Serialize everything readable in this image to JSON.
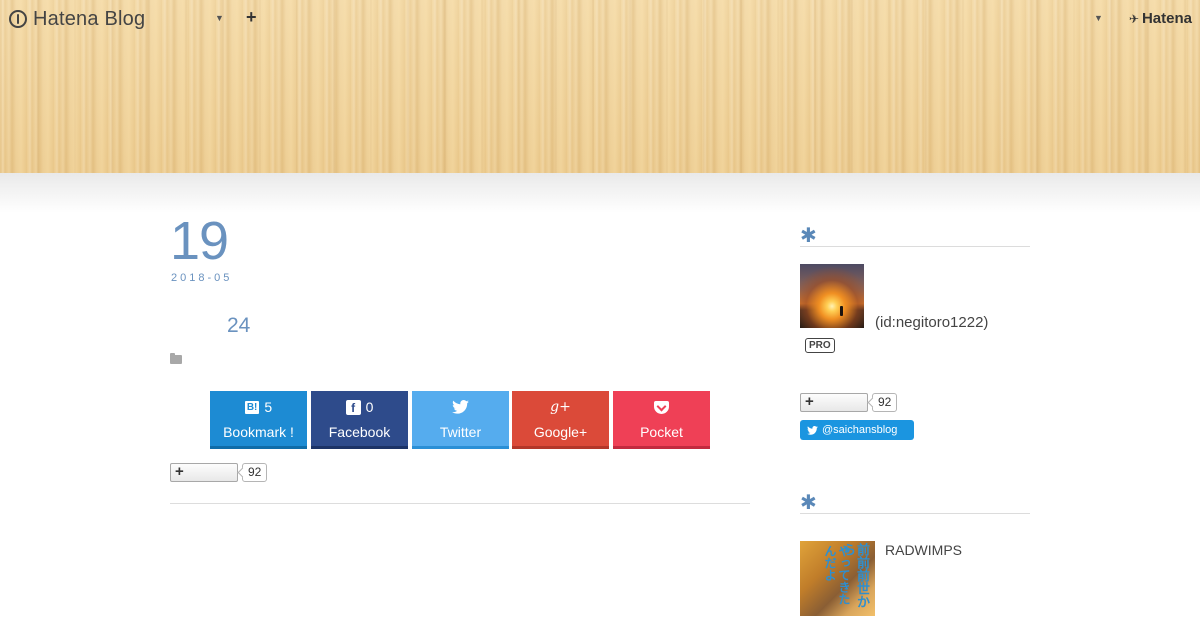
{
  "header": {
    "blog_title": "Hatena Blog",
    "add_icon": "plus-icon",
    "brand": "Hatena"
  },
  "article": {
    "day": "19",
    "year_month": "2018-05",
    "title": "24",
    "category_icon": "folder-icon"
  },
  "share": {
    "hatena": {
      "count": "5",
      "label": "Bookmark !",
      "icon": "B!"
    },
    "facebook": {
      "count": "0",
      "label": "Facebook",
      "icon": "f"
    },
    "twitter": {
      "label": "Twitter",
      "icon": "twitter-bird-icon"
    },
    "gplus": {
      "label": "Google+",
      "icon": "g+"
    },
    "pocket": {
      "label": "Pocket",
      "icon": "pocket-icon"
    }
  },
  "subscribe": {
    "plus": "+",
    "count": "92"
  },
  "sidebar": {
    "profile": {
      "heading_icon": "✱",
      "id_text": "(id:negitoro1222)",
      "badge": "PRO",
      "subscribe_plus": "+",
      "subscribe_count": "92",
      "twitter_follow": "@saichansblog"
    },
    "module2": {
      "heading_icon": "✱",
      "album_art_text": "前前前世から",
      "album_art_text2": "やってきたんだよ",
      "item_title": "RADWIMPS"
    }
  },
  "colors": {
    "accent": "#6a92bf",
    "hatena_blue": "#1d8bd3",
    "facebook": "#2e4b8b",
    "twitter": "#55acee",
    "gplus": "#db4a39",
    "pocket": "#ef4056"
  }
}
